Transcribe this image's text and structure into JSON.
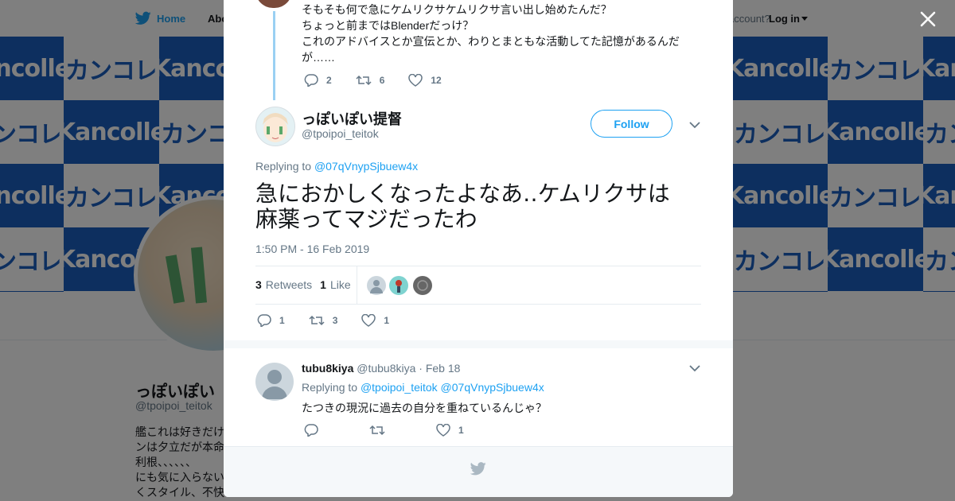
{
  "nav": {
    "home": "Home",
    "about": "Abo",
    "account_prompt": "account?",
    "login": "Log in"
  },
  "banner": {
    "tile_text_1": "Kancolle",
    "tile_text_2": "カンコレ",
    "colors": {
      "blue": "#1b5fbf"
    }
  },
  "background_profile": {
    "name": "っぽいぽい",
    "handle": "@tpoipoi_teitok",
    "bio_lines": [
      "艦これは好きだけ",
      "ンは夕立だが本命",
      "利根、、、、、、",
      "にも気に入らない",
      "くスタイル、不快"
    ]
  },
  "parent_tweet": {
    "lines": [
      "そもそも何で急にケムリクサケムリクサ言い出し始めたんだ？",
      "ちょっと前まではBlenderだっけ？",
      "これのアドバイスとか宣伝とか、わりとまともな活動してた記憶があるんだ",
      "が……"
    ],
    "replies": "2",
    "retweets": "6",
    "likes": "12"
  },
  "main_tweet": {
    "name": "っぽいぽい提督",
    "handle": "@tpoipoi_teitok",
    "follow_label": "Follow",
    "replying_prefix": "Replying to",
    "replying_to": "@07qVnypSjbuew4x",
    "text_line1": "急におかしくなったよなあ‥ケムリクサは",
    "text_line2": "麻薬ってマジだったわ",
    "timestamp": "1:50 PM - 16 Feb 2019",
    "retweet_count": "3",
    "retweet_label": "Retweets",
    "like_count": "1",
    "like_label": "Like",
    "replies": "1",
    "retweets": "3",
    "likes": "1"
  },
  "reply_tweet": {
    "name": "tubu8kiya",
    "handle": "@tubu8kiya",
    "date": "· Feb 18",
    "replying_prefix": "Replying to",
    "replying_to_1": "@tpoipoi_teitok",
    "replying_to_2": "@07qVnypSjbuew4x",
    "text": "たつきの現況に過去の自分を重ねているんじゃ？",
    "replies": "",
    "retweets": "",
    "likes": "1"
  },
  "colors": {
    "accent": "#1da1f2",
    "text": "#14171a",
    "muted": "#657786"
  }
}
